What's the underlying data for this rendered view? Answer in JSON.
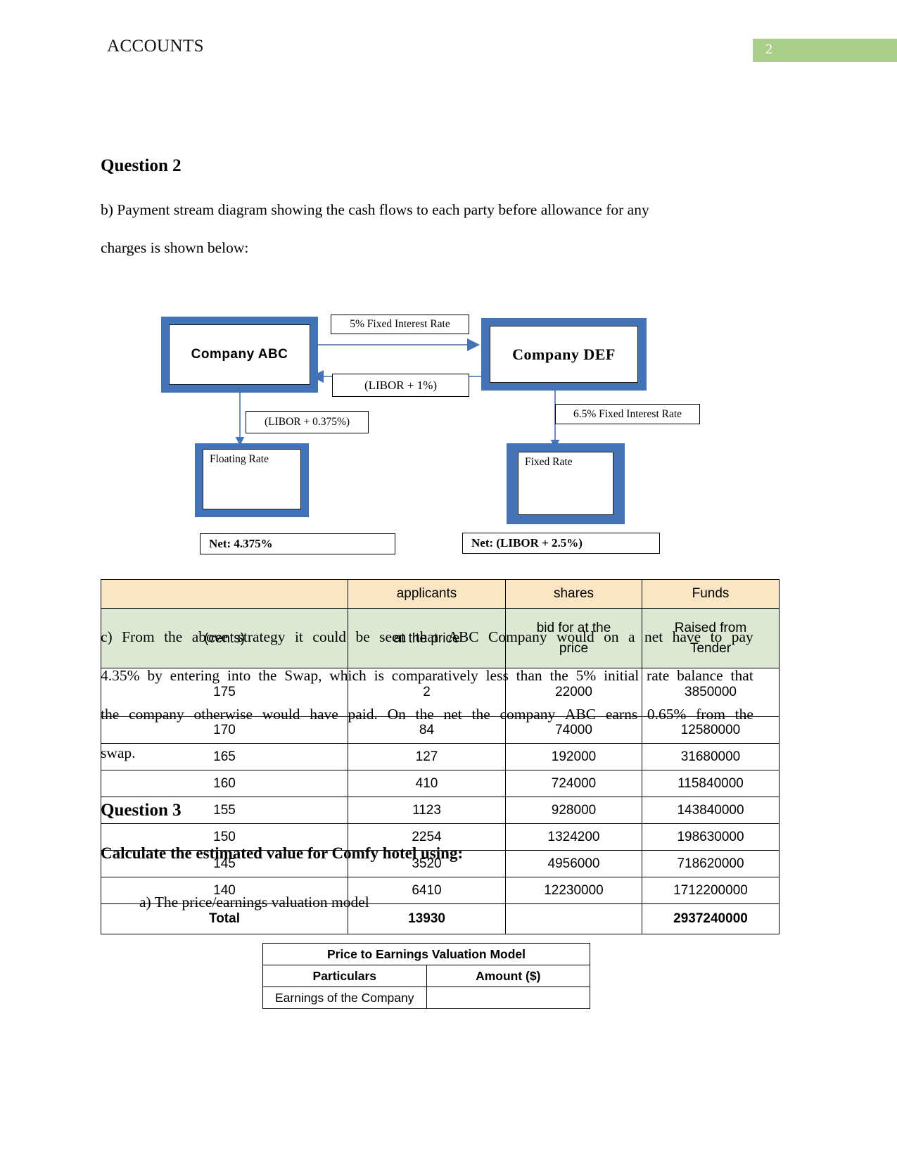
{
  "header": {
    "title": "ACCOUNTS",
    "page_number": "2",
    "badge_color": "#A8CE89"
  },
  "question2": {
    "heading": "Question 2",
    "intro_line1": "b) Payment stream diagram showing the cash flows to each party before allowance for any",
    "intro_line2": "charges is shown below:"
  },
  "diagram": {
    "box_abc": "Company ABC",
    "box_def": "Company DEF",
    "box_floating": "Floating   Rate",
    "box_fixed": "Fixed Rate",
    "label_fixed_5": "5% Fixed Interest Rate",
    "label_libor_1": "(LIBOR + 1%)",
    "label_libor_0375": "(LIBOR + 0.375%)",
    "label_fixed_65": "6.5% Fixed Interest Rate",
    "net_left": "Net: 4.375%",
    "net_right": "Net: (LIBOR + 2.5%)",
    "accent_color": "#4472B6"
  },
  "paragraph_c": {
    "line1_words": [
      "c)",
      "From",
      "the",
      "above",
      "strategy",
      "it",
      "could",
      "be",
      "seen",
      "that",
      "ABC",
      "Company",
      "would",
      "on",
      "a",
      "net",
      "have",
      "to",
      "pay"
    ],
    "line2_words": [
      "4.35%",
      "by",
      "entering",
      "into",
      "the",
      "Swap,",
      "which",
      "is",
      "comparatively",
      "less",
      "than",
      "the",
      "5%",
      "initial",
      "rate",
      "balance",
      "that"
    ],
    "line3_words": [
      "the",
      "company",
      "otherwise",
      "would",
      "have",
      "paid.",
      "On",
      "the",
      "net",
      "the",
      "company",
      "ABC",
      "earns",
      "0.65%",
      "from",
      "the"
    ],
    "line4": "swap."
  },
  "question3": {
    "heading": "Question 3",
    "instruction": "Calculate the estimated value for Comfy hotel using:",
    "list_item_a": "a)   The price/earnings valuation model"
  },
  "tender_table": {
    "header_row1": [
      "",
      "applicants",
      "shares",
      "Funds"
    ],
    "header_row2_lines": [
      [
        "(cents)"
      ],
      [
        "at the price"
      ],
      [
        "bid for at the",
        "price"
      ],
      [
        "Raised from",
        "Tender"
      ]
    ],
    "rows": [
      [
        "175",
        "2",
        "22000",
        "3850000"
      ],
      [
        "170",
        "84",
        "74000",
        "12580000"
      ],
      [
        "165",
        "127",
        "192000",
        "31680000"
      ],
      [
        "160",
        "410",
        "724000",
        "115840000"
      ],
      [
        "155",
        "1123",
        "928000",
        "143840000"
      ],
      [
        "150",
        "2254",
        "1324200",
        "198630000"
      ],
      [
        "145",
        "3520",
        "4956000",
        "718620000"
      ],
      [
        "140",
        "6410",
        "12230000",
        "1712200000"
      ]
    ],
    "total_row": [
      "Total",
      "13930",
      "",
      "2937240000"
    ],
    "header_color_1": "#FBE6C4",
    "header_color_2": "#DDE8D3"
  },
  "pe_table": {
    "title": "Price to Earnings Valuation Model",
    "col_particulars": "Particulars",
    "col_amount": "Amount ($)",
    "row_earnings_label": "Earnings of the Company",
    "row_earnings_value": ""
  }
}
